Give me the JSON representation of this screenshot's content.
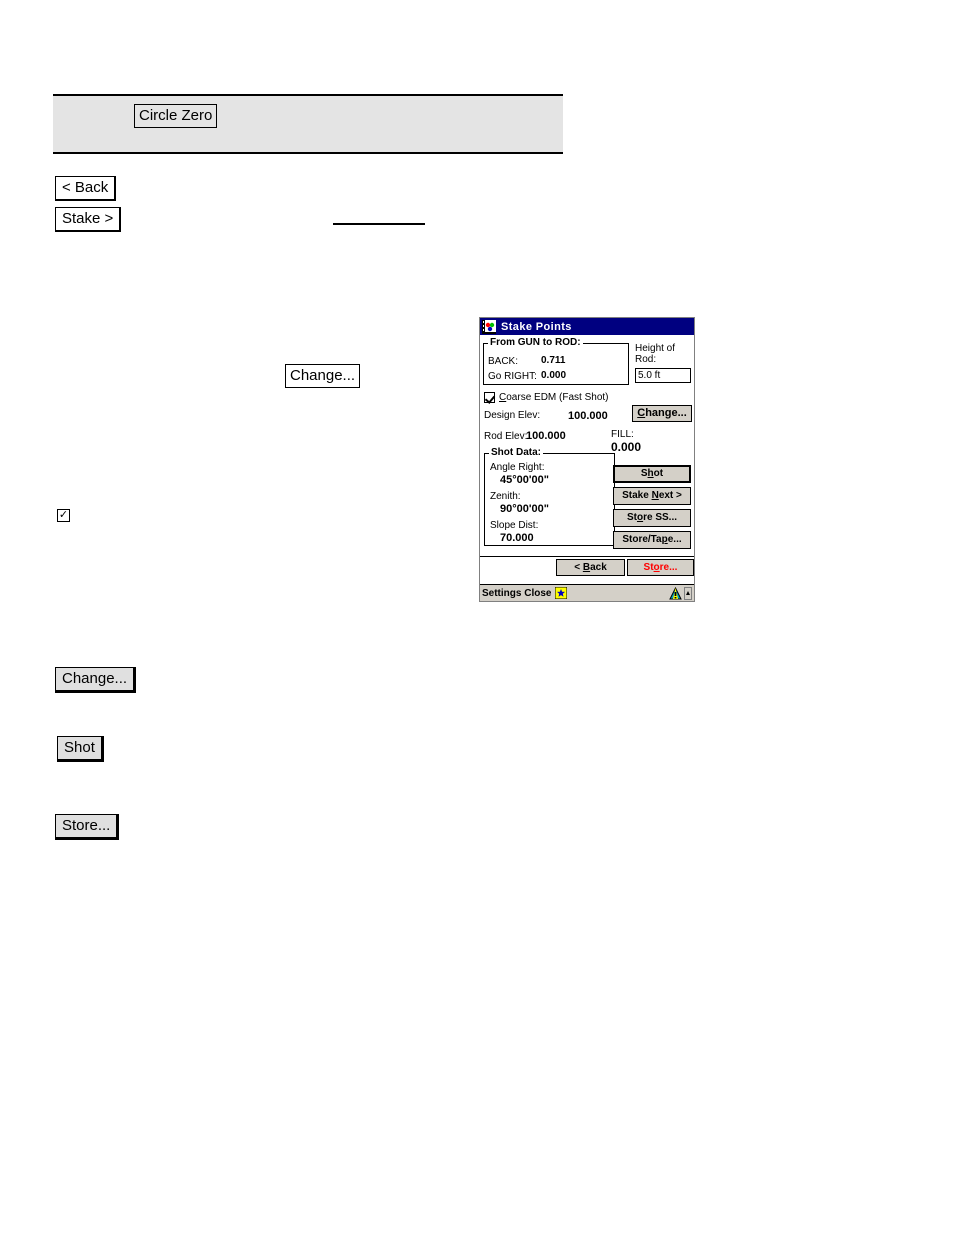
{
  "page": {
    "callouts": {
      "circle_zero": "Circle Zero",
      "back": "< Back",
      "stake": "Stake >",
      "change_top": "Change...",
      "change_bottom": "Change...",
      "shot": "Shot",
      "store": "Store..."
    }
  },
  "pda": {
    "title": "Stake Points",
    "title_icon": "stake-points-icon",
    "gun_to_rod": {
      "legend": "From GUN to ROD:",
      "rows": [
        {
          "label": "BACK:",
          "value": "0.711"
        },
        {
          "label": "Go RIGHT:",
          "value": "0.000"
        }
      ]
    },
    "height_of_rod": {
      "label_line1": "Height of",
      "label_line2": "Rod:",
      "value": "5.0 ft"
    },
    "coarse_edm": {
      "label_before": "C",
      "label_after": "oarse EDM (Fast Shot)",
      "checked": true
    },
    "design_elev": {
      "label": "Design Elev:",
      "value": "100.000"
    },
    "change_button": {
      "accel": "C",
      "rest": "hange..."
    },
    "rod_elev": {
      "label": "Rod Elev:",
      "value": "100.000"
    },
    "fill": {
      "label": "FILL:",
      "value": "0.000"
    },
    "shot_data": {
      "legend": "Shot Data:",
      "rows": [
        {
          "label": "Angle Right:",
          "value": "45°00'00\""
        },
        {
          "label": "Zenith:",
          "value": "90°00'00\""
        },
        {
          "label": "Slope Dist:",
          "value": "70.000"
        }
      ]
    },
    "buttons": [
      {
        "pre": "S",
        "accel": "h",
        "post": "ot"
      },
      {
        "pre": "Stake ",
        "accel": "N",
        "post": "ext >"
      },
      {
        "pre": "St",
        "accel": "o",
        "post": "re SS..."
      },
      {
        "pre": "Store/Ta",
        "accel": "p",
        "post": "e..."
      }
    ],
    "back_button": {
      "pre": "< ",
      "accel": "B",
      "post": "ack"
    },
    "store_button": {
      "pre": "St",
      "accel": "o",
      "post": "re..."
    },
    "statusbar": {
      "text": "Settings Close",
      "star_icon": "star-icon",
      "warn_icon": "warning-icon",
      "up_icon": "scroll-up-icon"
    },
    "colors": {
      "titlebar": "#000080",
      "button_face": "#d4d0c8",
      "store_text": "#ff0000"
    }
  }
}
